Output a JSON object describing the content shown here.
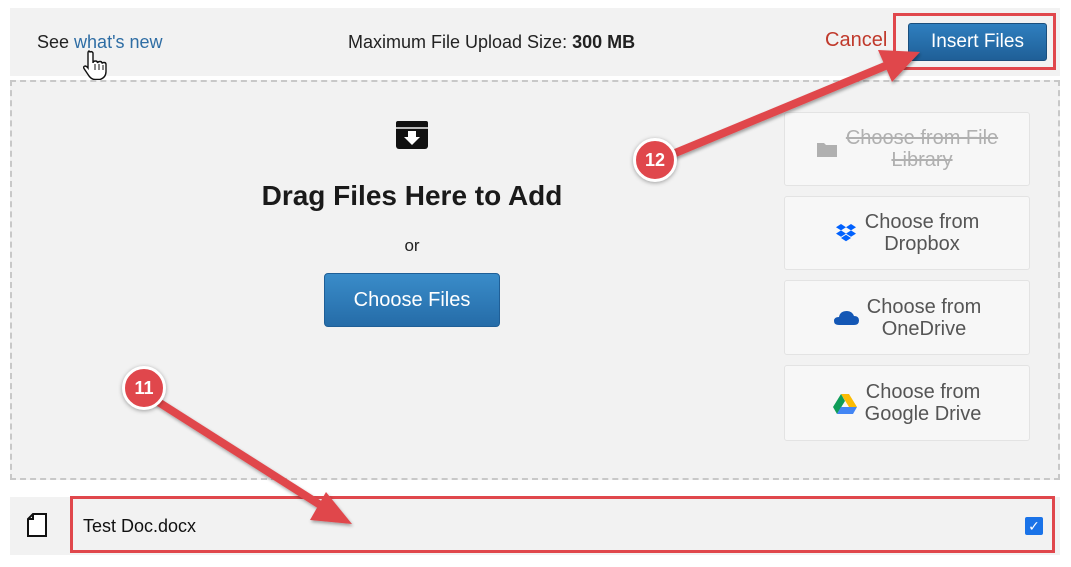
{
  "header": {
    "see_prefix": "See",
    "whats_new_link": "what's new",
    "max_size_label": "Maximum File Upload Size:",
    "max_size_value": "300 MB",
    "cancel_label": "Cancel",
    "insert_label": "Insert Files"
  },
  "dropzone": {
    "title": "Drag Files Here to Add",
    "or_text": "or",
    "choose_files_label": "Choose Files",
    "sources": [
      {
        "label_line1": "Choose from File",
        "label_line2": "Library",
        "icon": "folder-icon",
        "disabled": true
      },
      {
        "label_line1": "Choose from",
        "label_line2": "Dropbox",
        "icon": "dropbox-icon",
        "disabled": false
      },
      {
        "label_line1": "Choose from",
        "label_line2": "OneDrive",
        "icon": "onedrive-icon",
        "disabled": false
      },
      {
        "label_line1": "Choose from",
        "label_line2": "Google Drive",
        "icon": "google-drive-icon",
        "disabled": false
      }
    ]
  },
  "file_list": [
    {
      "name": "Test Doc.docx",
      "checked": true
    }
  ],
  "annotations": {
    "badge_11": "11",
    "badge_12": "12"
  },
  "colors": {
    "accent_blue": "#2e6da4",
    "cancel_red": "#c0392b",
    "annotation_red": "#e0474c",
    "checkbox_blue": "#1a73e8"
  }
}
